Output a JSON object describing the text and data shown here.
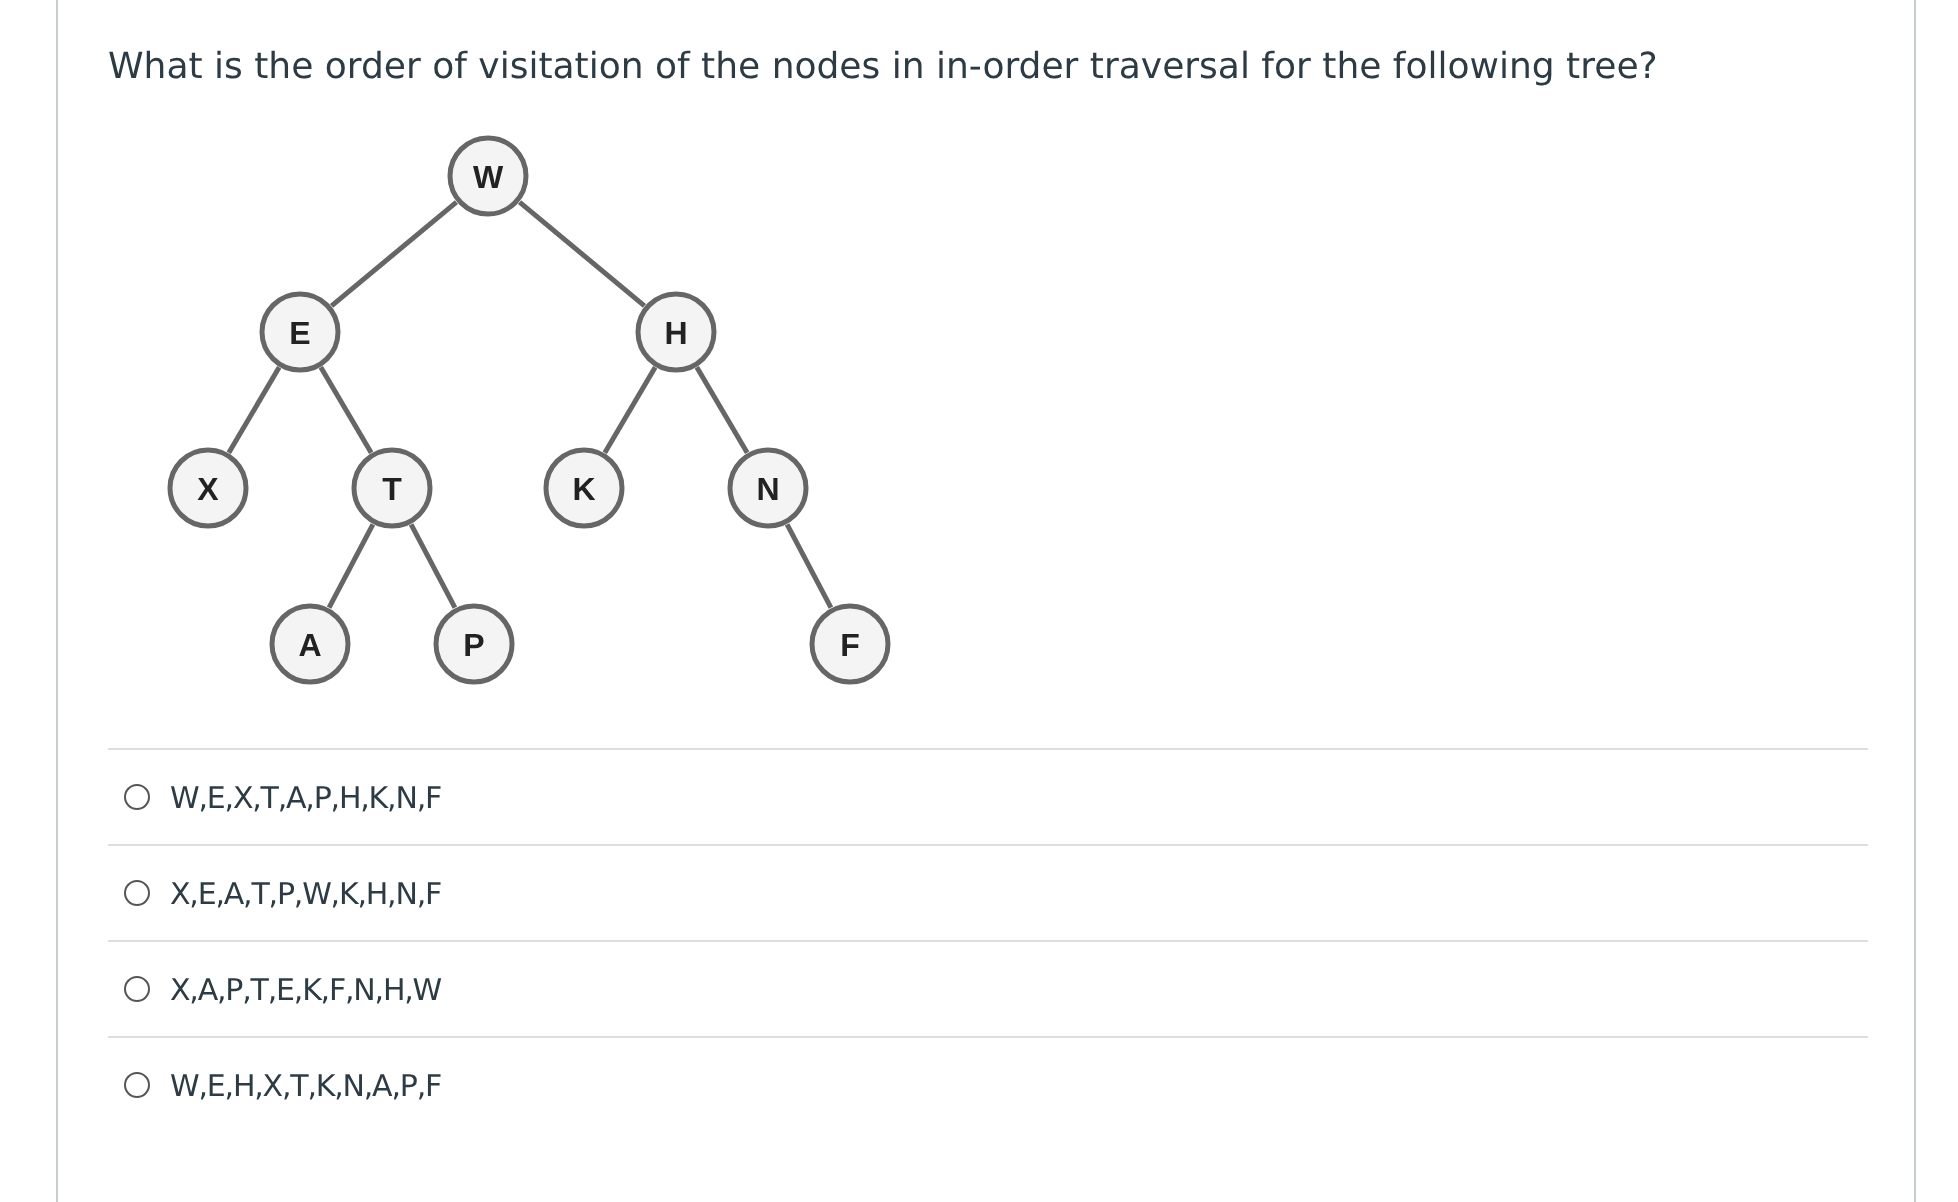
{
  "question": {
    "text": "What is the order of visitation of the nodes in in-order traversal for the following tree?"
  },
  "tree": {
    "label": "W",
    "left": {
      "label": "E",
      "left": {
        "label": "X"
      },
      "right": {
        "label": "T",
        "left": {
          "label": "A"
        },
        "right": {
          "label": "P"
        }
      }
    },
    "right": {
      "label": "H",
      "left": {
        "label": "K"
      },
      "right": {
        "label": "N",
        "right": {
          "label": "F"
        }
      }
    }
  },
  "options": [
    {
      "label": "W,E,X,T,A,P,H,K,N,F",
      "selected": false
    },
    {
      "label": "X,E,A,T,P,W,K,H,N,F",
      "selected": false
    },
    {
      "label": "X,A,P,T,E,K,F,N,H,W",
      "selected": false
    },
    {
      "label": "W,E,H,X,T,K,N,A,P,F",
      "selected": false
    }
  ]
}
